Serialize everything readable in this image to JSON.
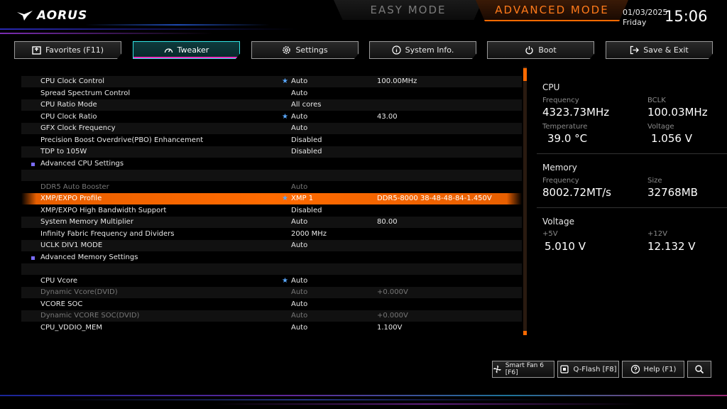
{
  "brand": {
    "logo": "AORUS"
  },
  "modes": {
    "easy": "EASY MODE",
    "advanced": "ADVANCED MODE"
  },
  "datetime": {
    "date": "01/03/2025",
    "day": "Friday",
    "time": "15:06"
  },
  "tabs": [
    {
      "label": "Favorites (F11)",
      "icon": "favorites-icon"
    },
    {
      "label": "Tweaker",
      "icon": "speedometer-icon"
    },
    {
      "label": "Settings",
      "icon": "gear-icon"
    },
    {
      "label": "System Info.",
      "icon": "info-icon"
    },
    {
      "label": "Boot",
      "icon": "power-icon"
    },
    {
      "label": "Save & Exit",
      "icon": "exit-icon"
    }
  ],
  "settings": [
    {
      "label": "CPU Clock Control",
      "star": true,
      "value": "Auto",
      "value2": "100.00MHz"
    },
    {
      "label": "Spread Spectrum Control",
      "value": "Auto"
    },
    {
      "label": "CPU Ratio Mode",
      "value": "All cores"
    },
    {
      "label": "CPU Clock Ratio",
      "star": true,
      "value": "Auto",
      "value2": "43.00"
    },
    {
      "label": "GFX Clock Frequency",
      "value": "Auto"
    },
    {
      "label": "Precision Boost Overdrive(PBO) Enhancement",
      "value": "Disabled"
    },
    {
      "label": "TDP to 105W",
      "value": "Disabled"
    },
    {
      "label": "Advanced CPU Settings",
      "submenu": true
    },
    {
      "label": "DDR5 Auto Booster",
      "value": "Auto",
      "dim": true
    },
    {
      "label": "XMP/EXPO Profile",
      "star": true,
      "value": "XMP 1",
      "value2": "DDR5-8000 38-48-48-84-1.450V",
      "selected": true
    },
    {
      "label": "XMP/EXPO High Bandwidth Support",
      "value": "Disabled"
    },
    {
      "label": "System Memory Multiplier",
      "value": "Auto",
      "value2": "80.00"
    },
    {
      "label": "Infinity Fabric Frequency and Dividers",
      "value": "2000 MHz"
    },
    {
      "label": "UCLK DIV1 MODE",
      "value": "Auto"
    },
    {
      "label": "Advanced Memory Settings",
      "submenu": true
    },
    {
      "label": "CPU Vcore",
      "star": true,
      "value": "Auto"
    },
    {
      "label": "Dynamic Vcore(DVID)",
      "value": "Auto",
      "value2": "+0.000V",
      "dim": true
    },
    {
      "label": "VCORE SOC",
      "value": "Auto"
    },
    {
      "label": "Dynamic VCORE SOC(DVID)",
      "value": "Auto",
      "value2": "+0.000V",
      "dim": true
    },
    {
      "label": "CPU_VDDIO_MEM",
      "value": "Auto",
      "value2": "1.100V"
    }
  ],
  "monitor": {
    "cpu": {
      "title": "CPU",
      "freq_label": "Frequency",
      "freq": "4323.73MHz",
      "bclk_label": "BCLK",
      "bclk": "100.03MHz",
      "temp_label": "Temperature",
      "temp": "39.0 °C",
      "volt_label": "Voltage",
      "volt": "1.056 V"
    },
    "memory": {
      "title": "Memory",
      "freq_label": "Frequency",
      "freq": "8002.72MT/s",
      "size_label": "Size",
      "size": "32768MB"
    },
    "voltage": {
      "title": "Voltage",
      "v5_label": "+5V",
      "v5": "5.010 V",
      "v12_label": "+12V",
      "v12": "12.132 V"
    }
  },
  "bottom": {
    "smartfan": "Smart Fan 6 [F6]",
    "qflash": "Q-Flash [F8]",
    "help": "Help (F1)"
  },
  "colors": {
    "accent": "#ff6a00",
    "tab_active": "#32e6e6",
    "star": "#5aa8ff"
  }
}
